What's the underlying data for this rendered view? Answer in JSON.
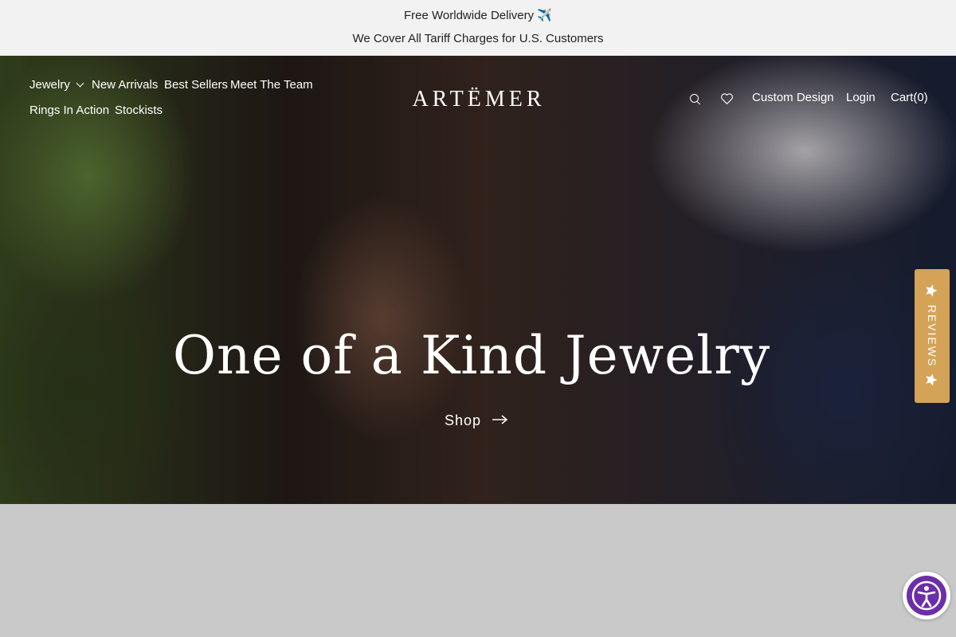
{
  "announcement": {
    "line1": "Free Worldwide Delivery ✈️",
    "line2": "We Cover All Tariff Charges for U.S. Customers"
  },
  "nav_left": {
    "jewelry": "Jewelry",
    "new_arrivals": "New Arrivals",
    "best_sellers": "Best Sellers",
    "meet_the_team": "Meet The Team",
    "rings_in_action": "Rings In Action",
    "stockists": "Stockists"
  },
  "logo": {
    "text": "ARTËMER"
  },
  "nav_right": {
    "search_icon": "search-icon",
    "wishlist_icon": "heart-icon",
    "custom_design": "Custom Design",
    "login": "Login",
    "cart": "Cart(0)"
  },
  "hero": {
    "headline": "One of a Kind Jewelry",
    "cta": "Shop"
  },
  "reviews_tab": {
    "label": "REVIEWS",
    "icon": "star-icon",
    "color": "#d4a358"
  },
  "accessibility": {
    "icon": "accessibility-icon",
    "color": "#6c2ea8"
  }
}
